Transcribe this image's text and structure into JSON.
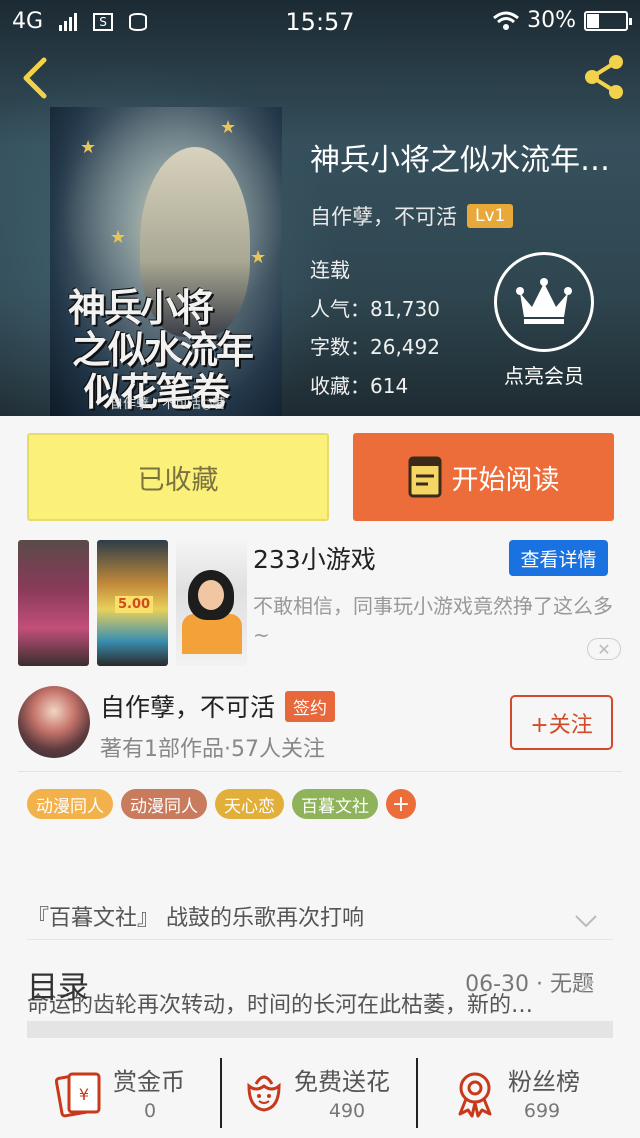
{
  "status_bar": {
    "network": "4G",
    "time": "15:57",
    "battery": "30%"
  },
  "book": {
    "title": "神兵小将之似水流年…",
    "cover_title_lines": [
      "神兵小将",
      "之似水流年",
      "似花笔卷"
    ],
    "cover_author": "自作孽，不可活○著",
    "author": "自作孽，不可活",
    "level": "Lv1",
    "status": "连载",
    "popularity": "人气：81,730",
    "word_count": "字数：26,492",
    "favorites": "收藏：614",
    "vip_label": "点亮会员"
  },
  "actions": {
    "collect": "已收藏",
    "read": "开始阅读"
  },
  "ad": {
    "title": "233小游戏",
    "detail_button": "查看详情",
    "description": "不敢相信，同事玩小游戏竟然挣了这么多~",
    "thumb_amount": "5.00"
  },
  "author_card": {
    "name": "自作孽，不可活",
    "badge": "签约",
    "subtitle": "著有1部作品·57人关注",
    "follow_button": "+关注"
  },
  "tags": [
    {
      "label": "动漫同人",
      "color": "#f2b14a"
    },
    {
      "label": "动漫同人",
      "color": "#c97b5e"
    },
    {
      "label": "天心恋",
      "color": "#e2b03a"
    },
    {
      "label": "百暮文社",
      "color": "#8fb35a"
    }
  ],
  "tag_add": "+",
  "intro": {
    "line1": "『百暮文社』    战鼓的乐歌再次打响",
    "line2": "命运的齿轮再次转动，时间的长河在此枯萎，新的…"
  },
  "toc": {
    "label": "目录",
    "latest": "06-30 · 无题"
  },
  "bottom_bar": {
    "reward": {
      "label": "赏金币",
      "value": "0"
    },
    "flowers": {
      "label": "免费送花",
      "value": "490"
    },
    "fans": {
      "label": "粉丝榜",
      "value": "699"
    }
  },
  "colors": {
    "accent": "#ec6c3a",
    "collect_bg": "#fbf07a",
    "link_blue": "#1a72e0",
    "follow_red": "#d14a2a"
  }
}
